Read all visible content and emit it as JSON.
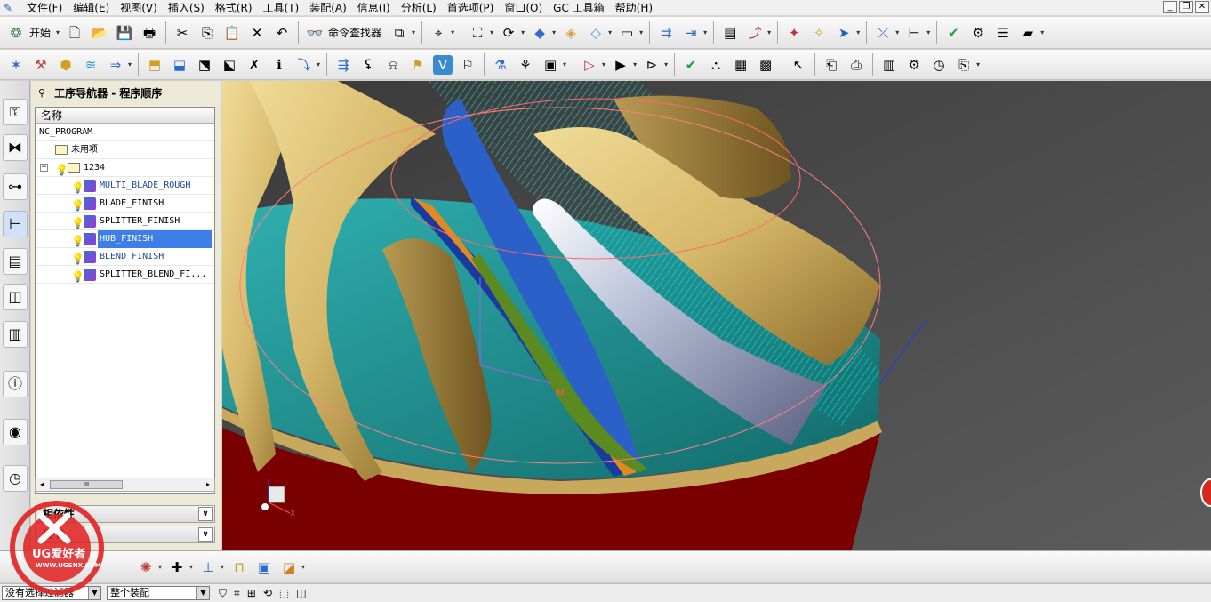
{
  "menubar": {
    "items": [
      "文件(F)",
      "编辑(E)",
      "视图(V)",
      "插入(S)",
      "格式(R)",
      "工具(T)",
      "装配(A)",
      "信息(I)",
      "分析(L)",
      "首选项(P)",
      "窗口(O)",
      "GC 工具箱",
      "帮助(H)"
    ]
  },
  "toolbar": {
    "start_label": "开始",
    "finder_label": "命令查找器"
  },
  "navigator": {
    "title": "工序导航器 - 程序顺序",
    "column_name": "名称",
    "rows": [
      {
        "text": "NC_PROGRAM"
      },
      {
        "text": "未用项"
      },
      {
        "text": "1234"
      },
      {
        "text": "MULTI_BLADE_ROUGH"
      },
      {
        "text": "BLADE_FINISH"
      },
      {
        "text": "SPLITTER_FINISH"
      },
      {
        "text": "HUB_FINISH"
      },
      {
        "text": "BLEND_FINISH"
      },
      {
        "text": "SPLITTER_BLEND_FI..."
      }
    ],
    "selected_row": "HUB_FINISH",
    "hscroll_thumb": "III",
    "panel_dependency": "相依性",
    "panel_details": "细节"
  },
  "statusbar": {
    "filter_value": "没有选择过滤器",
    "scope_value": "整个装配"
  },
  "watermark": {
    "logo_text": "UG爱好者",
    "logo_url": "WWW.UGSNX.COM"
  },
  "viewport": {
    "axis_label_x": "X",
    "axis_label_m": "M",
    "colors": {
      "background": "#4c4c4c",
      "base_red": "#7a0000",
      "blade_gold": "#d4b86a",
      "hub_teal": "#1e8a8a",
      "toolpath_cyan": "#00e0e0",
      "surface_blue": "#2a60c8"
    }
  }
}
